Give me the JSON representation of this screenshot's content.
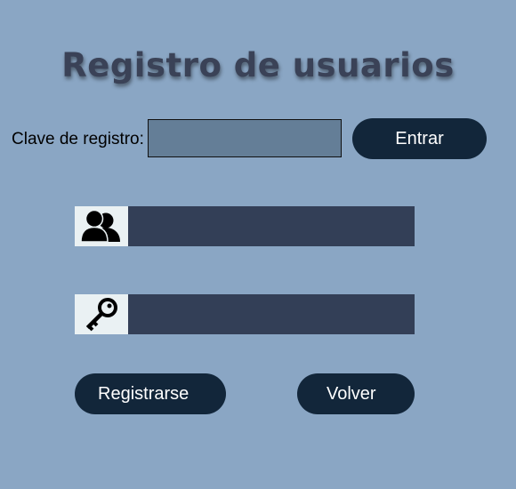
{
  "page": {
    "title": "Registro de usuarios"
  },
  "registration_key": {
    "label": "Clave de registro:",
    "value": "",
    "placeholder": "",
    "enter_button": "Entrar"
  },
  "form": {
    "username": {
      "icon": "users-icon",
      "value": "",
      "placeholder": ""
    },
    "password": {
      "icon": "key-icon",
      "value": "",
      "placeholder": ""
    },
    "register_button": "Registrarse",
    "back_button": "Volver"
  },
  "colors": {
    "background": "#8aa6c4",
    "button": "#12263a",
    "field": "#333f57",
    "key_input": "#647e97",
    "icon_box": "#eaf1f3",
    "title": "#3a4257"
  }
}
